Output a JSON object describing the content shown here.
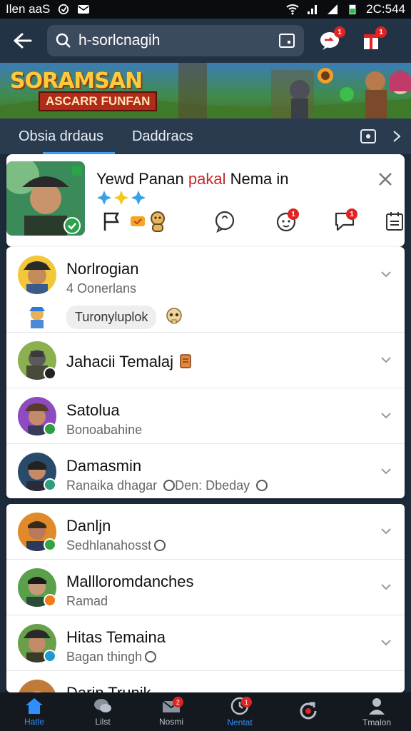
{
  "status_bar": {
    "carrier": "Ilen aaS",
    "time": "2C:544"
  },
  "search": {
    "value": "h-sorlcnagih"
  },
  "banner": {
    "title": "SORAMSAN",
    "subtitle": "ASCARR FUNFAN"
  },
  "tabs": [
    {
      "label": "Obsia drdaus"
    },
    {
      "label": "Daddracs"
    }
  ],
  "card": {
    "name_part1": "Yewd Panan ",
    "name_part2": "pakal",
    "name_part3": " Nema in",
    "badges": {
      "notifications": "1",
      "messages": "1"
    }
  },
  "list1": [
    {
      "title": "Norlrogian",
      "subtitle": "4 Oonerlans",
      "chip": "Turonyluplok",
      "status_color": ""
    },
    {
      "title": "Jahacii Temalaj",
      "subtitle": "",
      "status_color": "#222222"
    },
    {
      "title": "Satolua",
      "subtitle": "Bonoabahine",
      "status_color": "#2e9e3e"
    },
    {
      "title": "Damasmin",
      "subtitle": "Ranaika dhagar",
      "subtitle2": "Den: Dbeday",
      "status_color": "#2e9e7e"
    }
  ],
  "list2": [
    {
      "title": "Danljn",
      "subtitle": "Sedhlanahosst",
      "status_color": "#34a340"
    },
    {
      "title": "Mallloromdanches",
      "subtitle": "Ramad",
      "status_color": "#f07a1a"
    },
    {
      "title": "Hitas Temaina",
      "subtitle": "Bagan thingh",
      "status_color": "#1f9bd1"
    },
    {
      "title": "Darin Trunik",
      "subtitle": "",
      "status_color": "#888888"
    }
  ],
  "topbar_badges": {
    "alerts": "1",
    "gift": "1"
  },
  "bottom_nav": [
    {
      "label": "Hatle",
      "badge": ""
    },
    {
      "label": "Lilst",
      "badge": ""
    },
    {
      "label": "Nosmi",
      "badge": "2"
    },
    {
      "label": "Nentat",
      "badge": "1"
    },
    {
      "label": "",
      "badge": ""
    },
    {
      "label": "Tmalon",
      "badge": ""
    }
  ],
  "colors": {
    "accent": "#2f8fff",
    "topbar": "#233346",
    "badge": "#e02424"
  }
}
